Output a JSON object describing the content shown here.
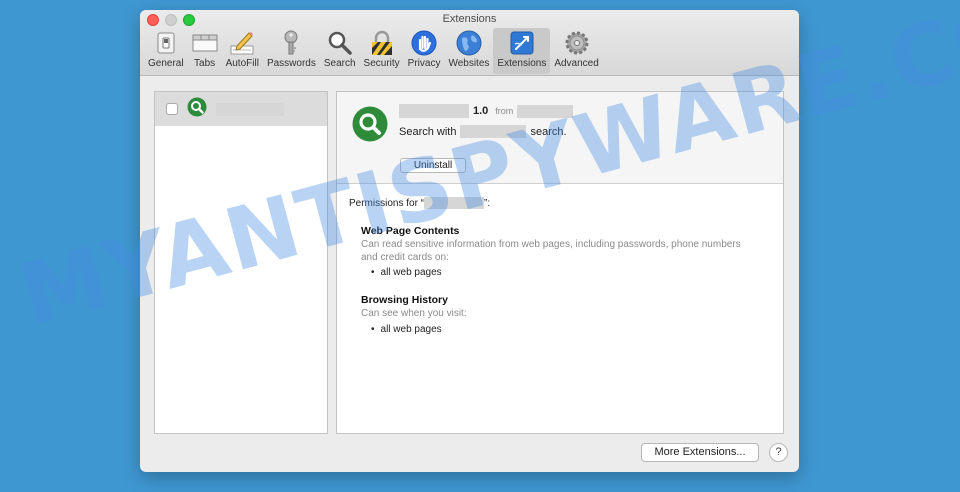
{
  "watermark": "MYANTISPYWARE.COM",
  "window": {
    "title": "Extensions"
  },
  "toolbar": {
    "items": [
      {
        "label": "General",
        "icon": "general-switch-icon"
      },
      {
        "label": "Tabs",
        "icon": "tabs-icon"
      },
      {
        "label": "AutoFill",
        "icon": "autofill-pencil-icon"
      },
      {
        "label": "Passwords",
        "icon": "key-icon"
      },
      {
        "label": "Search",
        "icon": "magnifier-icon"
      },
      {
        "label": "Security",
        "icon": "lock-icon"
      },
      {
        "label": "Privacy",
        "icon": "hand-icon"
      },
      {
        "label": "Websites",
        "icon": "globe-icon"
      },
      {
        "label": "Extensions",
        "icon": "puzzle-icon",
        "active": true
      },
      {
        "label": "Advanced",
        "icon": "gear-icon"
      }
    ]
  },
  "extension": {
    "enabled": false,
    "version": "1.0",
    "from_label": "from",
    "search_prefix": "Search with",
    "search_suffix": "search.",
    "uninstall_label": "Uninstall"
  },
  "permissions": {
    "header_prefix": "Permissions for “",
    "header_suffix": "”:",
    "sections": [
      {
        "title": "Web Page Contents",
        "description": "Can read sensitive information from web pages, including passwords, phone numbers and credit cards on:",
        "items": [
          "all web pages"
        ]
      },
      {
        "title": "Browsing History",
        "description": "Can see when you visit:",
        "items": [
          "all web pages"
        ]
      }
    ]
  },
  "footer": {
    "more_extensions_label": "More Extensions...",
    "help_label": "?"
  },
  "colors": {
    "background": "#3f97d1",
    "accent_green": "#2e8b3a",
    "traffic_close": "#fe5f57",
    "traffic_max": "#29c940"
  }
}
